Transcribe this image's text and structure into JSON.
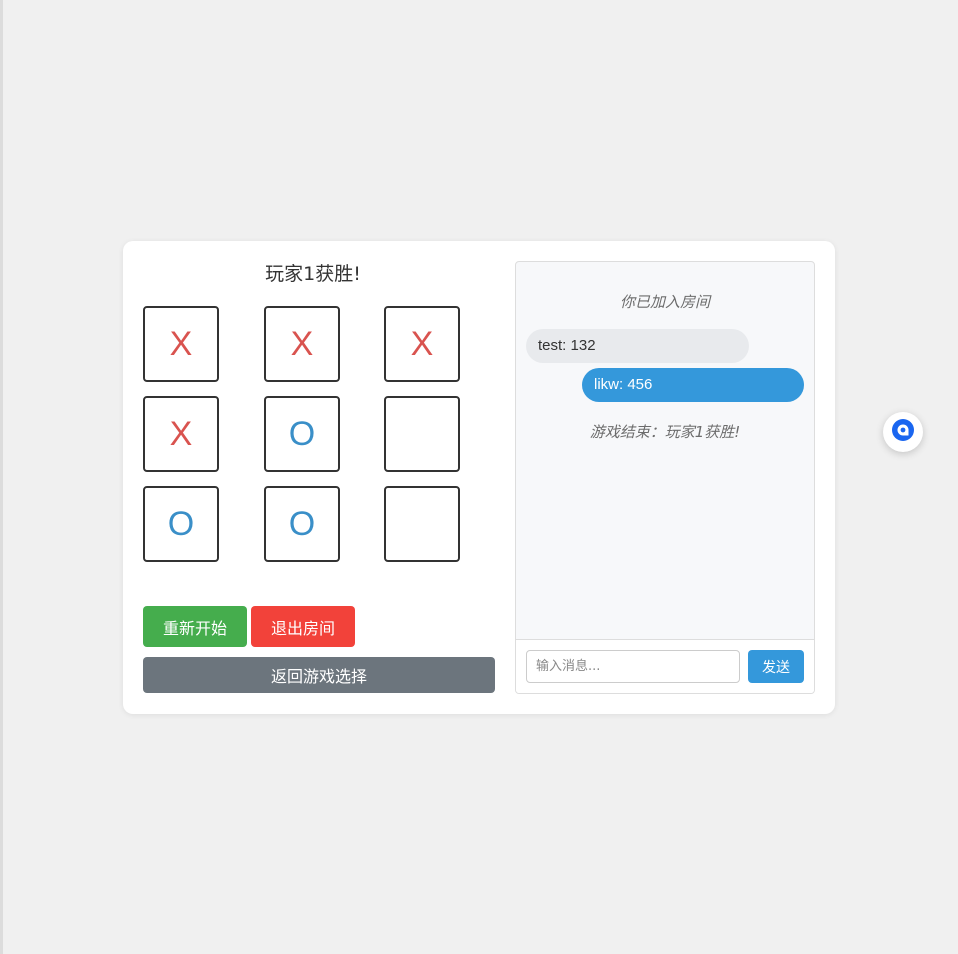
{
  "game": {
    "status": "玩家1获胜!",
    "board": [
      "X",
      "X",
      "X",
      "X",
      "O",
      "",
      "O",
      "O",
      ""
    ],
    "buttons": {
      "restart": "重新开始",
      "leave": "退出房间",
      "back": "返回游戏选择"
    }
  },
  "chat": {
    "joined_notice": "你已加入房间",
    "messages": [
      {
        "from": "other",
        "text": "test: 132"
      },
      {
        "from": "self",
        "text": "likw: 456"
      }
    ],
    "game_over_notice": "游戏结束：玩家1获胜!",
    "input_placeholder": "输入消息...",
    "input_value": "",
    "send_label": "发送"
  },
  "colors": {
    "x_mark": "#d9534f",
    "o_mark": "#3a8fc8",
    "restart": "#45ad4d",
    "leave": "#f2423a",
    "back": "#6c757d",
    "accent": "#3498db"
  },
  "icons": {
    "floating_widget": "chat-bubble-icon"
  }
}
